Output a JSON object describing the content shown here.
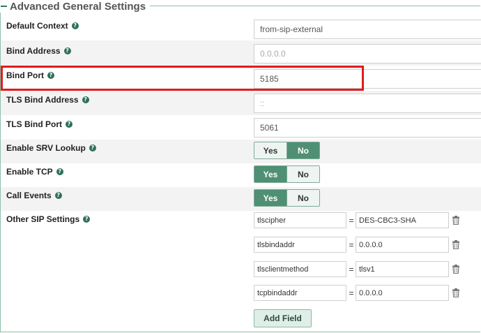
{
  "section": {
    "title": "Advanced General Settings"
  },
  "fields": {
    "default_context": {
      "label": "Default Context",
      "value": "from-sip-external"
    },
    "bind_address": {
      "label": "Bind Address",
      "placeholder": "0.0.0.0"
    },
    "bind_port": {
      "label": "Bind Port",
      "value": "5185"
    },
    "tls_bind_address": {
      "label": "TLS Bind Address",
      "placeholder": "::"
    },
    "tls_bind_port": {
      "label": "TLS Bind Port",
      "value": "5061"
    }
  },
  "toggles": {
    "yes_label": "Yes",
    "no_label": "No",
    "enable_srv_lookup": {
      "label": "Enable SRV Lookup",
      "selected": "No"
    },
    "enable_tcp": {
      "label": "Enable TCP",
      "selected": "Yes"
    },
    "call_events": {
      "label": "Call Events",
      "selected": "Yes"
    }
  },
  "other_sip": {
    "label": "Other SIP Settings",
    "equals": "=",
    "rows": [
      {
        "key": "tlscipher",
        "value": "DES-CBC3-SHA"
      },
      {
        "key": "tlsbindaddr",
        "value": "0.0.0.0"
      },
      {
        "key": "tlsclientmethod",
        "value": "tlsv1"
      },
      {
        "key": "tcpbindaddr",
        "value": "0.0.0.0"
      }
    ],
    "add_label": "Add Field"
  },
  "colors": {
    "accent": "#4f8f73",
    "highlight": "#e01b1b",
    "border": "#8cc0a8"
  },
  "icons": {
    "help": "question-circle-icon",
    "trash": "trash-icon"
  }
}
